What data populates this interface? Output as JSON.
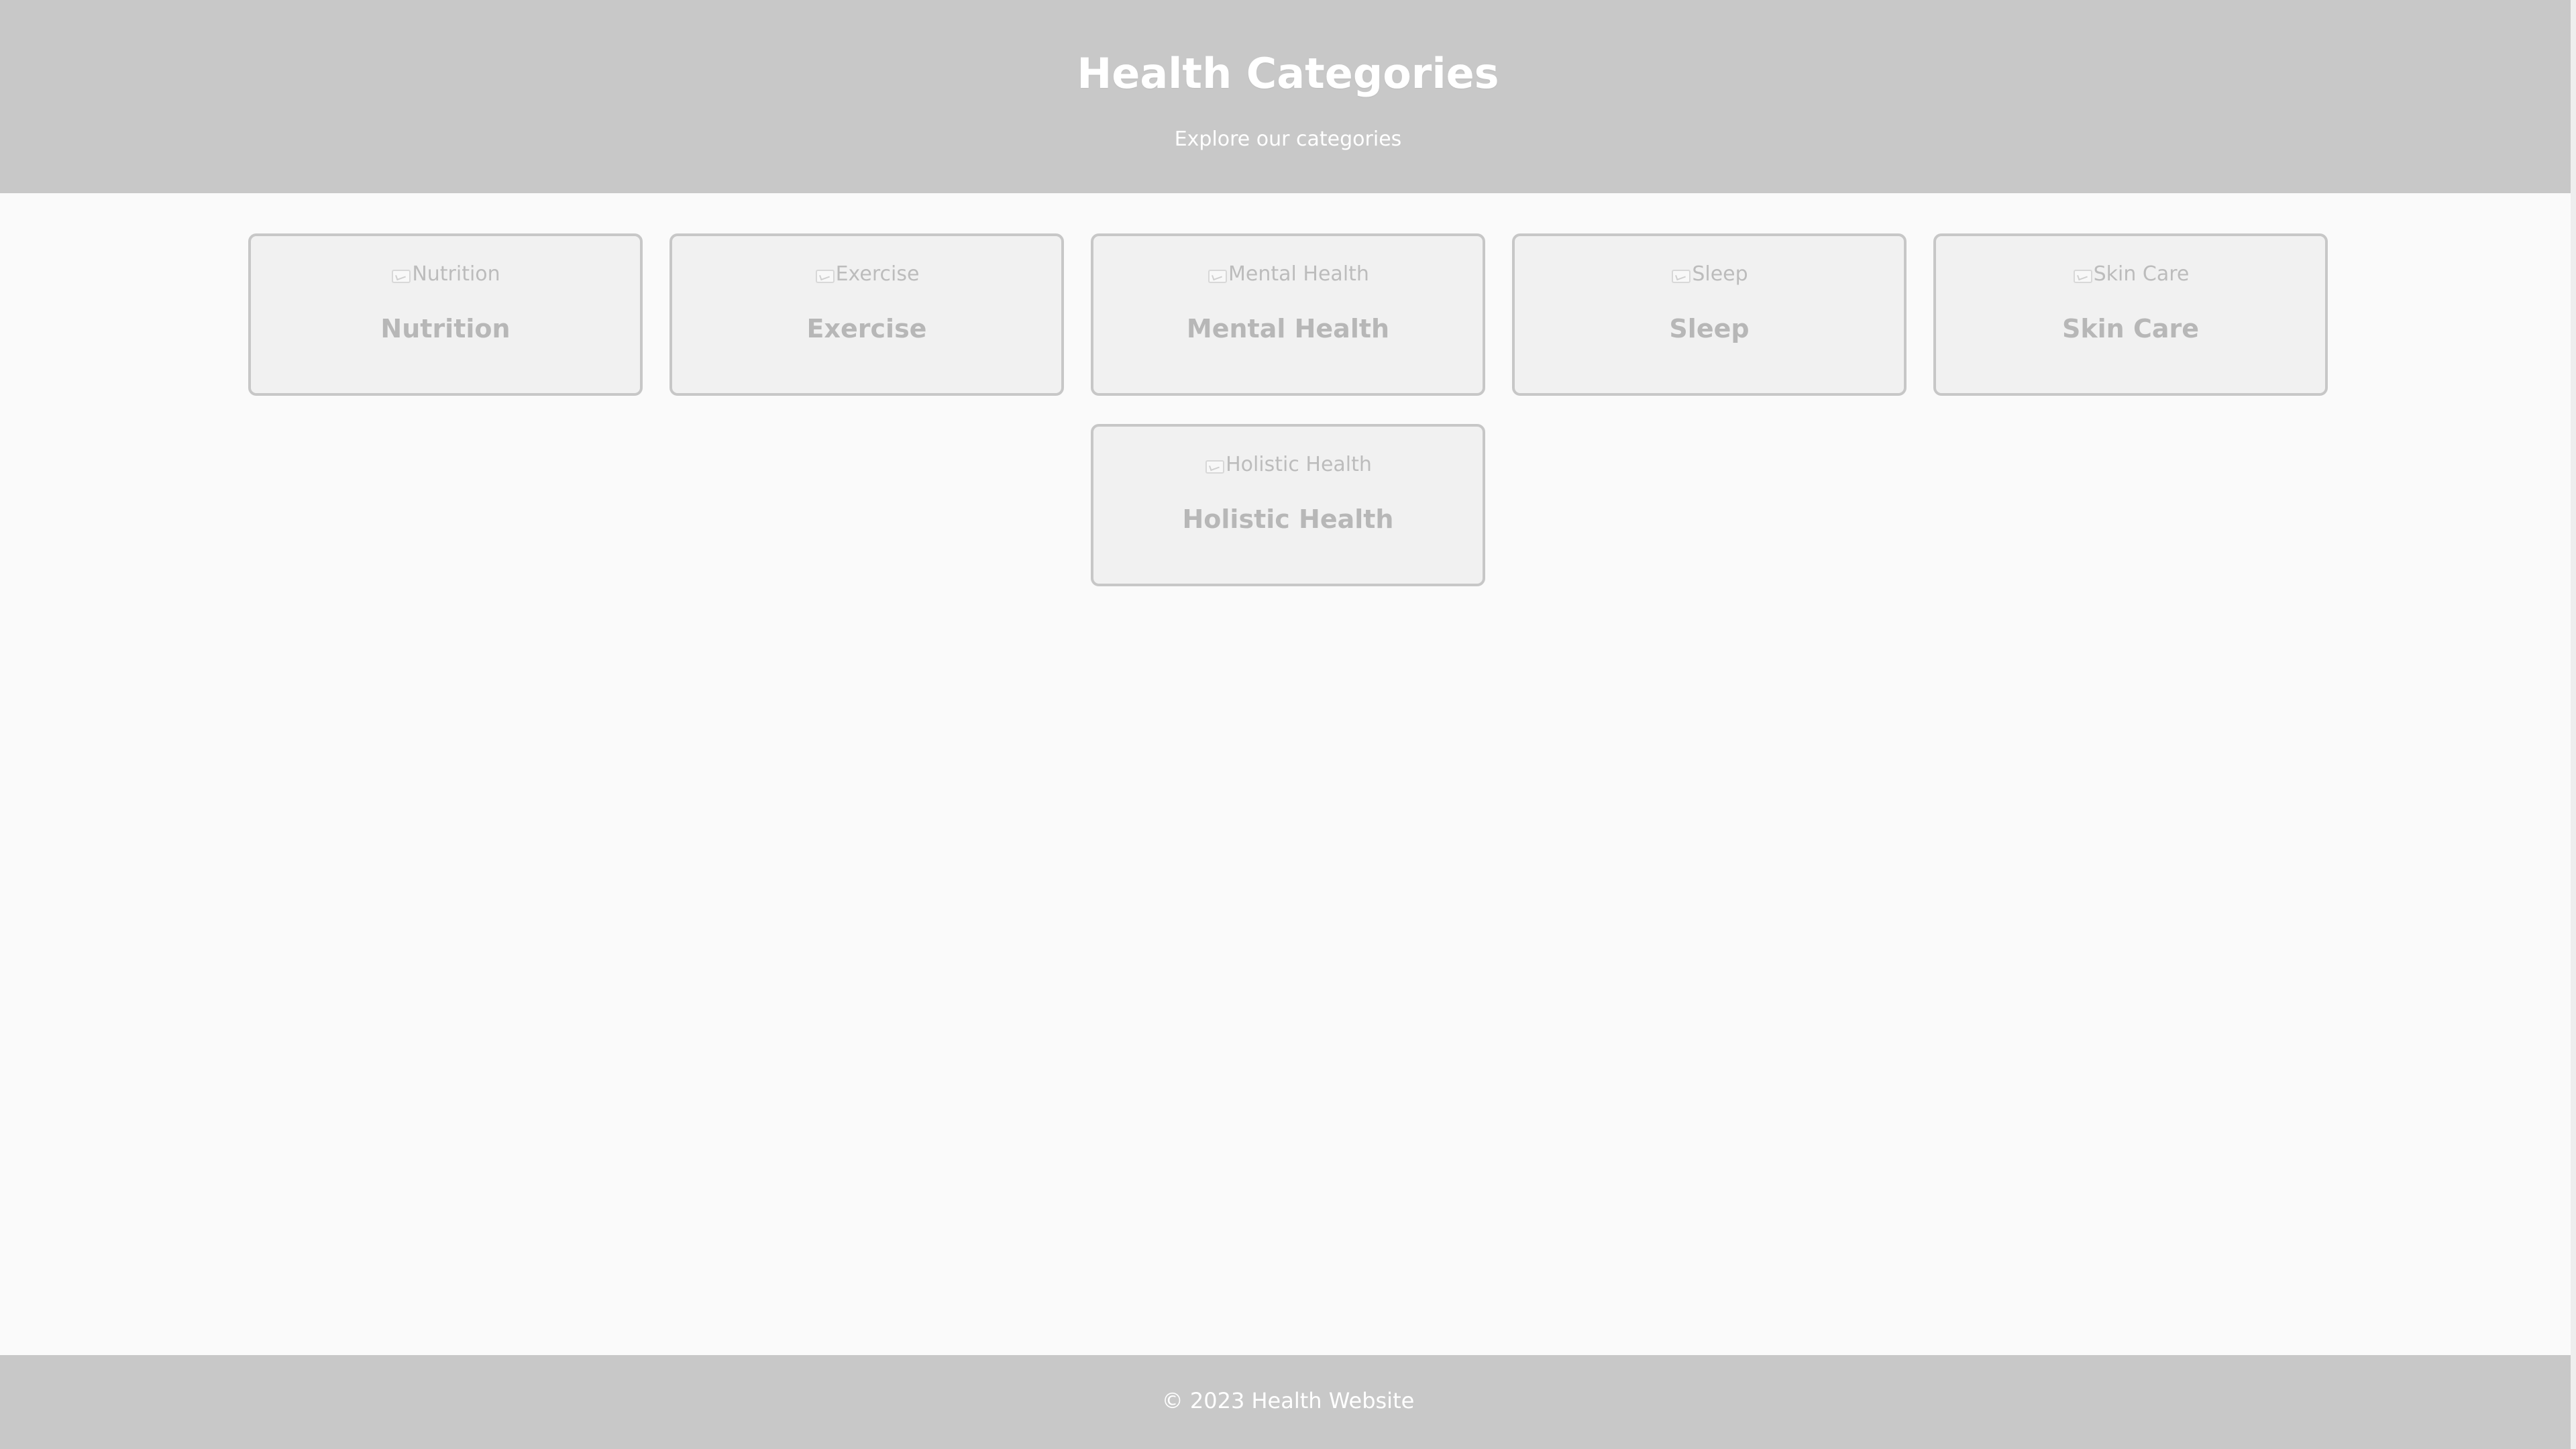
{
  "header": {
    "title": "Health Categories",
    "subtitle": "Explore our categories"
  },
  "categories": [
    {
      "image_alt": "Nutrition",
      "label": "Nutrition"
    },
    {
      "image_alt": "Exercise",
      "label": "Exercise"
    },
    {
      "image_alt": "Mental Health",
      "label": "Mental Health"
    },
    {
      "image_alt": "Sleep",
      "label": "Sleep"
    },
    {
      "image_alt": "Skin Care",
      "label": "Skin Care"
    },
    {
      "image_alt": "Holistic Health",
      "label": "Holistic Health"
    }
  ],
  "footer": {
    "copyright": "© 2023 Health Website"
  },
  "colors": {
    "header_bg": "#c8c8c8",
    "page_bg": "#fafafa",
    "card_bg": "#f1f1f1",
    "card_border": "#c7c7c7",
    "card_text": "#b7b7b7"
  },
  "icons": {
    "card_image": "broken-image-icon"
  }
}
